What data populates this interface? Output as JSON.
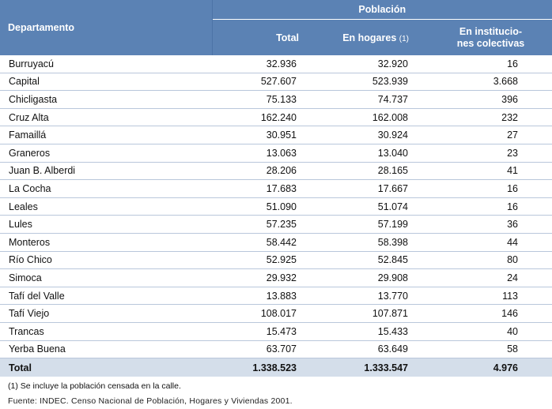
{
  "table": {
    "headers": {
      "departamento": "Departamento",
      "poblacion": "Población",
      "total": "Total",
      "en_hogares": "En hogares",
      "en_hogares_note": "(1)",
      "instituciones_line1": "En institucio-",
      "instituciones_line2": "nes colectivas"
    },
    "rows": [
      {
        "departamento": "Burruyacú",
        "total": "32.936",
        "en_hogares": "32.920",
        "instituciones": "16"
      },
      {
        "departamento": "Capital",
        "total": "527.607",
        "en_hogares": "523.939",
        "instituciones": "3.668"
      },
      {
        "departamento": "Chicligasta",
        "total": "75.133",
        "en_hogares": "74.737",
        "instituciones": "396"
      },
      {
        "departamento": "Cruz Alta",
        "total": "162.240",
        "en_hogares": "162.008",
        "instituciones": "232"
      },
      {
        "departamento": "Famaillá",
        "total": "30.951",
        "en_hogares": "30.924",
        "instituciones": "27"
      },
      {
        "departamento": "Graneros",
        "total": "13.063",
        "en_hogares": "13.040",
        "instituciones": "23"
      },
      {
        "departamento": "Juan B. Alberdi",
        "total": "28.206",
        "en_hogares": "28.165",
        "instituciones": "41"
      },
      {
        "departamento": "La Cocha",
        "total": "17.683",
        "en_hogares": "17.667",
        "instituciones": "16"
      },
      {
        "departamento": "Leales",
        "total": "51.090",
        "en_hogares": "51.074",
        "instituciones": "16"
      },
      {
        "departamento": "Lules",
        "total": "57.235",
        "en_hogares": "57.199",
        "instituciones": "36"
      },
      {
        "departamento": "Monteros",
        "total": "58.442",
        "en_hogares": "58.398",
        "instituciones": "44"
      },
      {
        "departamento": "Río Chico",
        "total": "52.925",
        "en_hogares": "52.845",
        "instituciones": "80"
      },
      {
        "departamento": "Simoca",
        "total": "29.932",
        "en_hogares": "29.908",
        "instituciones": "24"
      },
      {
        "departamento": "Tafí del Valle",
        "total": "13.883",
        "en_hogares": "13.770",
        "instituciones": "113"
      },
      {
        "departamento": "Tafí Viejo",
        "total": "108.017",
        "en_hogares": "107.871",
        "instituciones": "146"
      },
      {
        "departamento": "Trancas",
        "total": "15.473",
        "en_hogares": "15.433",
        "instituciones": "40"
      },
      {
        "departamento": "Yerba Buena",
        "total": "63.707",
        "en_hogares": "63.649",
        "instituciones": "58"
      }
    ],
    "total_row": {
      "departamento": "Total",
      "total": "1.338.523",
      "en_hogares": "1.333.547",
      "instituciones": "4.976"
    }
  },
  "footnote": "(1) Se incluye la población censada en la calle.",
  "source": "Fuente: INDEC. Censo Nacional de Población, Hogares y Viviendas 2001.",
  "colors": {
    "header_bg": "#5b82b4",
    "total_bg": "#d4deea",
    "row_border": "#b9c7db"
  }
}
